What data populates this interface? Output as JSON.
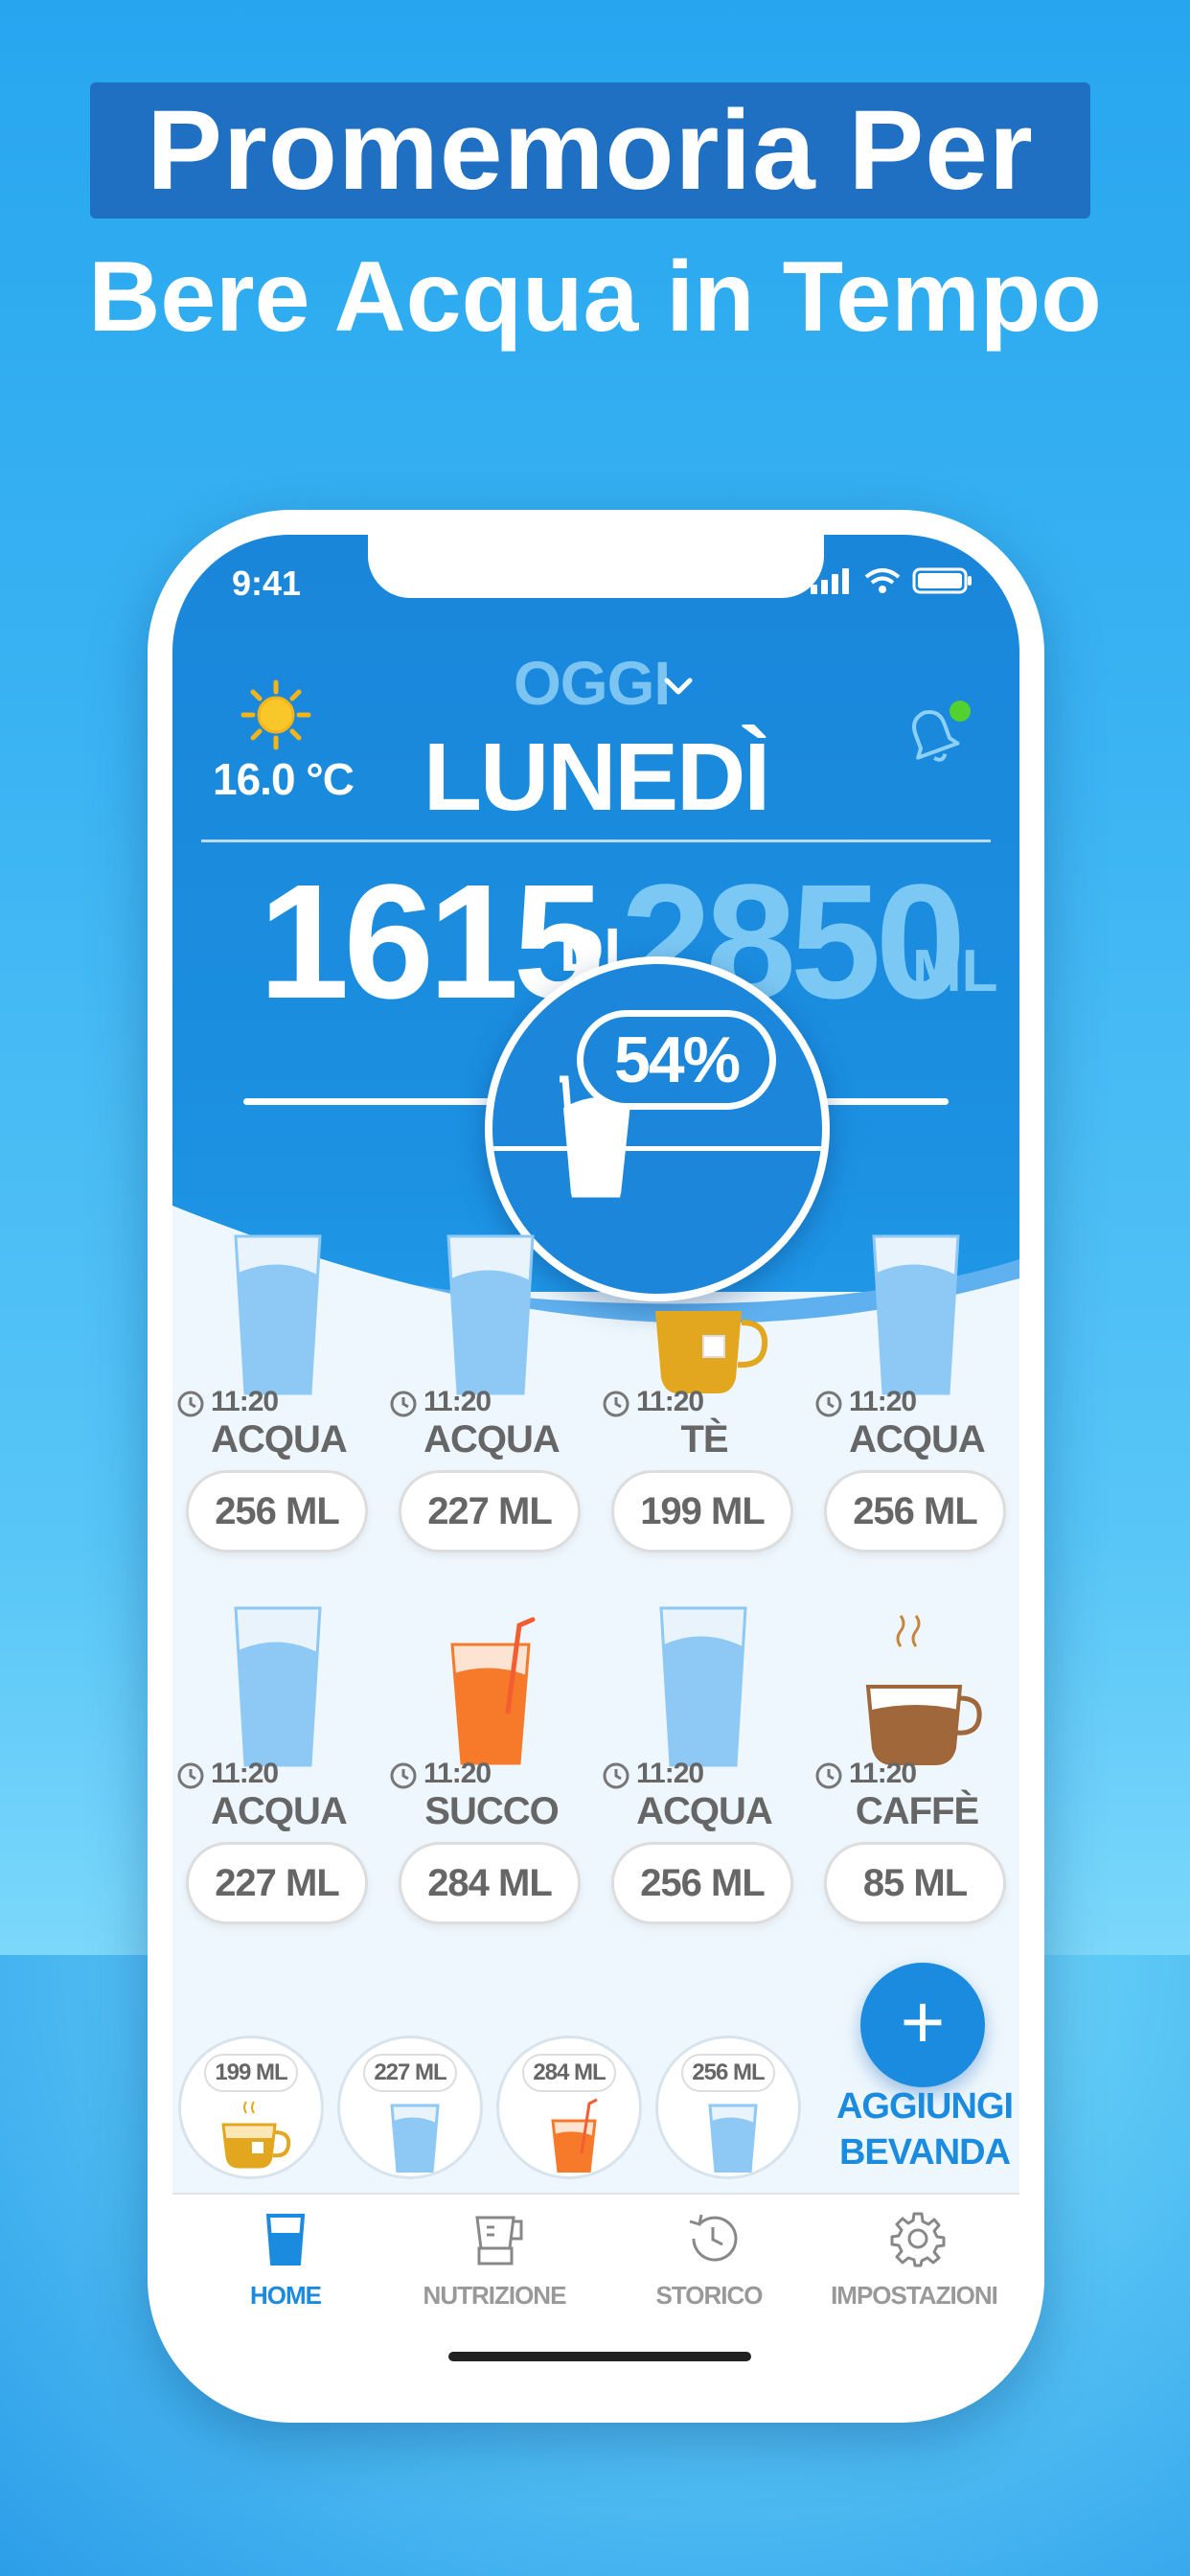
{
  "headline": {
    "line1": "Promemoria Per",
    "line2": "Bere Acqua in Tempo"
  },
  "status": {
    "time": "9:41"
  },
  "header": {
    "temperature": "16.0 °C",
    "period": "OGGI",
    "day": "LUNEDÌ",
    "weather_icon": "sun-icon",
    "reminder_icon": "bell-icon"
  },
  "summary": {
    "consumed": "1615",
    "of": "DI",
    "goal": "2850",
    "unit": "ML",
    "percent": "54%",
    "progress": 0.54
  },
  "drinks": [
    {
      "time": "11:20",
      "name": "ACQUA",
      "amount": "256 ML",
      "type": "water"
    },
    {
      "time": "11:20",
      "name": "ACQUA",
      "amount": "227 ML",
      "type": "water"
    },
    {
      "time": "11:20",
      "name": "TÈ",
      "amount": "199 ML",
      "type": "tea"
    },
    {
      "time": "11:20",
      "name": "ACQUA",
      "amount": "256 ML",
      "type": "water"
    },
    {
      "time": "11:20",
      "name": "ACQUA",
      "amount": "227 ML",
      "type": "water"
    },
    {
      "time": "11:20",
      "name": "SUCCO",
      "amount": "284 ML",
      "type": "juice"
    },
    {
      "time": "11:20",
      "name": "ACQUA",
      "amount": "256 ML",
      "type": "water"
    },
    {
      "time": "11:20",
      "name": "CAFFÈ",
      "amount": "85 ML",
      "type": "coffee"
    }
  ],
  "quick_add": [
    {
      "amount": "199 ML",
      "type": "tea"
    },
    {
      "amount": "227 ML",
      "type": "water"
    },
    {
      "amount": "284 ML",
      "type": "juice"
    },
    {
      "amount": "256 ML",
      "type": "water"
    }
  ],
  "add_button": {
    "symbol": "+",
    "line1": "AGGIUNGI",
    "line2": "BEVANDA"
  },
  "tabs": [
    {
      "label": "HOME",
      "icon": "glass-icon",
      "active": true
    },
    {
      "label": "NUTRIZIONE",
      "icon": "blender-icon",
      "active": false
    },
    {
      "label": "STORICO",
      "icon": "history-icon",
      "active": false
    },
    {
      "label": "IMPOSTAZIONI",
      "icon": "gear-icon",
      "active": false
    }
  ],
  "colors": {
    "primary": "#1B8BE0",
    "water": "#8EC8F4",
    "tea": "#E2A71E",
    "juice": "#F77A2B",
    "coffee": "#A0673A"
  }
}
